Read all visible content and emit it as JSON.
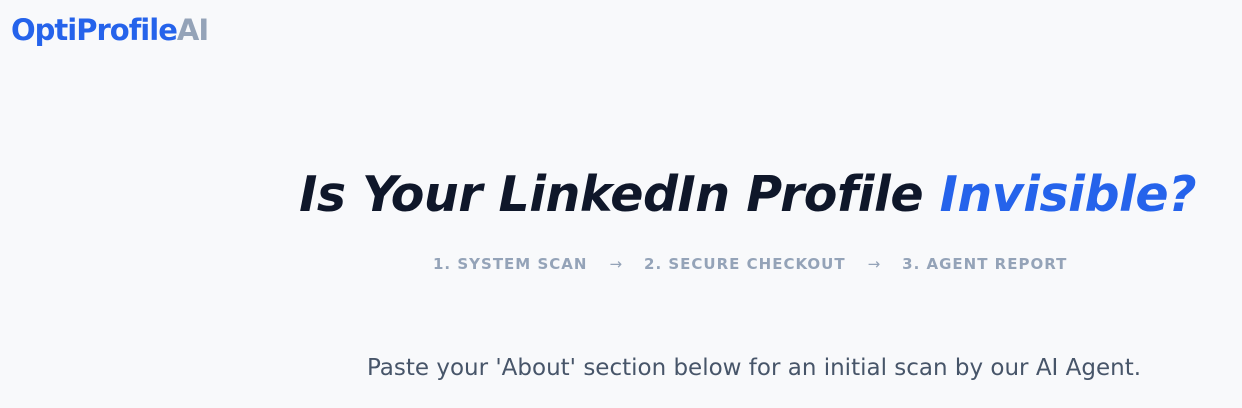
{
  "logo": {
    "brand": "OptiProfile",
    "suffix": "AI"
  },
  "hero": {
    "headline_main": "Is Your LinkedIn Profile ",
    "headline_accent": "Invisible?"
  },
  "steps": [
    {
      "label": "1. SYSTEM SCAN"
    },
    {
      "label": "2. SECURE CHECKOUT"
    },
    {
      "label": "3. AGENT REPORT"
    }
  ],
  "step_separator": "→",
  "intro_text": "Paste your 'About' section below for an initial scan by our AI Agent.",
  "colors": {
    "accent": "#2563eb",
    "heading": "#0f172a",
    "muted": "#94a3b8",
    "body_text": "#475569",
    "background": "#f8f9fb"
  }
}
